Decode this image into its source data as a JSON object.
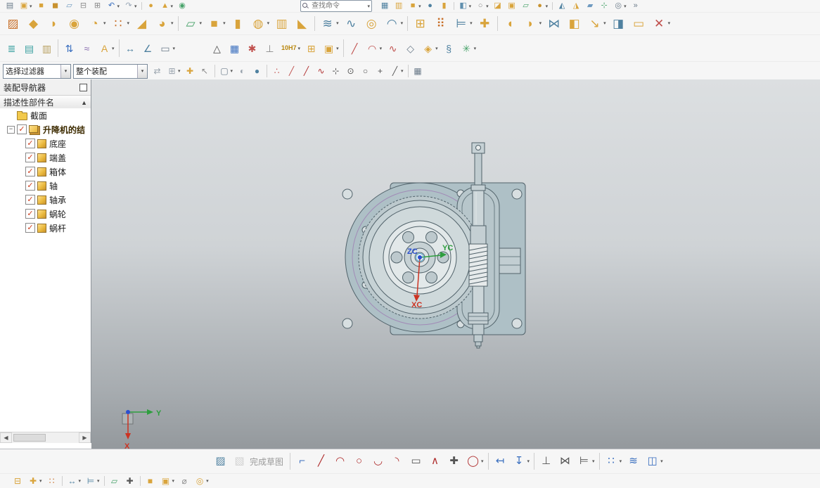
{
  "search": {
    "placeholder": "查找命令"
  },
  "filter_bar": {
    "filter": "选择过滤器",
    "scope": "整个装配"
  },
  "toolbars": {
    "row1a": [
      {
        "n": "window-split",
        "g": "▤",
        "c": "#6b7b8a"
      },
      {
        "n": "part-cube",
        "g": "▣",
        "c": "#d9a43c",
        "dd": true
      },
      {
        "n": "block",
        "g": "■",
        "c": "#d9a43c"
      },
      {
        "n": "cube-shaded",
        "g": "◼",
        "c": "#c8922f"
      },
      {
        "n": "sheet-body",
        "g": "▱",
        "c": "#6f9ac0"
      },
      {
        "n": "copy",
        "g": "⊟",
        "c": "#8a8a8a"
      },
      {
        "n": "paste",
        "g": "⊞",
        "c": "#8a8a8a"
      },
      {
        "n": "undo",
        "g": "↶",
        "c": "#3a6fbf",
        "dd": true
      },
      {
        "n": "redo",
        "g": "↷",
        "c": "#9aa8b8",
        "dd": true
      },
      {
        "sep": true
      },
      {
        "n": "sphere-tool",
        "g": "●",
        "c": "#d9a43c"
      },
      {
        "n": "cone-tool",
        "g": "▲",
        "c": "#d9a43c",
        "dd": true
      },
      {
        "n": "touch-mode",
        "g": "◉",
        "c": "#49a36b"
      }
    ],
    "row1b": [
      {
        "n": "window-grid",
        "g": "▦",
        "c": "#4f81a0"
      },
      {
        "n": "cascade-windows",
        "g": "▥",
        "c": "#d9a43c"
      },
      {
        "n": "cube-small",
        "g": "■",
        "c": "#d9a43c",
        "dd": true
      },
      {
        "n": "sphere-small",
        "g": "●",
        "c": "#4f81a0"
      },
      {
        "n": "cylinder-small",
        "g": "▮",
        "c": "#d9a43c"
      },
      {
        "sep": true
      },
      {
        "n": "shaded-view",
        "g": "◧",
        "c": "#5f8fae",
        "dd": true
      },
      {
        "n": "wireframe-view",
        "g": "○",
        "c": "#8a8a8a",
        "dd": true
      },
      {
        "n": "half-section-view",
        "g": "◪",
        "c": "#d9a43c"
      },
      {
        "n": "cube-pair",
        "g": "▣",
        "c": "#d9a43c"
      },
      {
        "n": "datum-plane-small",
        "g": "▱",
        "c": "#49a36b"
      },
      {
        "n": "sphere-gold",
        "g": "●",
        "c": "#c8922f",
        "dd": true
      },
      {
        "sep": true
      },
      {
        "n": "trim-view",
        "g": "◭",
        "c": "#4f81a0"
      },
      {
        "n": "extend-view",
        "g": "◮",
        "c": "#d9a43c"
      },
      {
        "n": "face-tool",
        "g": "▰",
        "c": "#6f9ac0"
      },
      {
        "n": "datum-axis",
        "g": "⊹",
        "c": "#49a36b"
      },
      {
        "n": "find-measure",
        "g": "◎",
        "c": "#6b7b8a",
        "dd": true
      },
      {
        "n": "more-tools",
        "g": "»",
        "c": "#6b7b8a"
      }
    ],
    "row2": [
      {
        "n": "direct-sketch",
        "g": "▨",
        "c": "#c8702a"
      },
      {
        "n": "extrude",
        "g": "◆",
        "c": "#d9a43c"
      },
      {
        "n": "revolve",
        "g": "◗",
        "c": "#d9a43c"
      },
      {
        "n": "hole",
        "g": "◉",
        "c": "#d9a43c"
      },
      {
        "n": "unite-boolean",
        "g": "◔",
        "c": "#d9a43c",
        "dd": true
      },
      {
        "n": "pattern-feature",
        "g": "∷",
        "c": "#c8702a",
        "dd": true
      },
      {
        "n": "chamfer",
        "g": "◢",
        "c": "#d9a43c"
      },
      {
        "n": "edge-blend",
        "g": "◕",
        "c": "#d9a43c",
        "dd": true
      },
      {
        "sep": true
      },
      {
        "n": "datum-plane",
        "g": "▱",
        "c": "#49a36b",
        "dd": true
      },
      {
        "n": "block-primitive",
        "g": "■",
        "c": "#d9a43c",
        "dd": true
      },
      {
        "n": "cylinder-primitive",
        "g": "▮",
        "c": "#d9a43c"
      },
      {
        "n": "boolean-ops",
        "g": "◍",
        "c": "#d9a43c",
        "dd": true
      },
      {
        "n": "shell",
        "g": "▥",
        "c": "#d9a43c"
      },
      {
        "n": "draft",
        "g": "◣",
        "c": "#d9a43c"
      },
      {
        "sep": true
      },
      {
        "n": "through-curves",
        "g": "≋",
        "c": "#4f81a0",
        "dd": true
      },
      {
        "n": "sweep-along-guide",
        "g": "∿",
        "c": "#4f81a0"
      },
      {
        "n": "tube",
        "g": "◎",
        "c": "#d9a43c"
      },
      {
        "n": "surface",
        "g": "◠",
        "c": "#4f81a0",
        "dd": true
      },
      {
        "sep": true
      },
      {
        "n": "add-component",
        "g": "⊞",
        "c": "#d9a43c"
      },
      {
        "n": "pattern-component",
        "g": "⠿",
        "c": "#c8702a"
      },
      {
        "n": "assembly-constraint",
        "g": "⊨",
        "c": "#4f81a0",
        "dd": true
      },
      {
        "n": "move-component",
        "g": "✚",
        "c": "#d9a43c"
      },
      {
        "sep": true
      },
      {
        "n": "face-blend",
        "g": "◖",
        "c": "#d9a43c"
      },
      {
        "n": "styled-blend",
        "g": "◗",
        "c": "#d9a43c",
        "dd": true
      },
      {
        "n": "sew",
        "g": "⋈",
        "c": "#4f81a0"
      },
      {
        "n": "thicken",
        "g": "◧",
        "c": "#d9a43c"
      },
      {
        "n": "scale-body",
        "g": "↘",
        "c": "#d9a43c",
        "dd": true
      },
      {
        "n": "offset-surface",
        "g": "◨",
        "c": "#4f81a0"
      },
      {
        "n": "replace-face",
        "g": "▭",
        "c": "#d9a43c"
      },
      {
        "n": "delete-face",
        "g": "✕",
        "c": "#c0504d",
        "dd": true
      }
    ],
    "row3": [
      {
        "n": "layer-stack",
        "g": "≣",
        "c": "#3aa0a0"
      },
      {
        "n": "sheet-stack",
        "g": "▤",
        "c": "#3aa0a0"
      },
      {
        "n": "pages",
        "g": "▥",
        "c": "#b8a060"
      },
      {
        "sep": true
      },
      {
        "n": "interpart-link",
        "g": "⇅",
        "c": "#3a6fbf"
      },
      {
        "n": "wave-geometry",
        "g": "≈",
        "c": "#8a6fb0"
      },
      {
        "n": "text-feature",
        "g": "A",
        "c": "#d9a43c",
        "dd": true
      },
      {
        "sep": true
      },
      {
        "n": "dimension-linear",
        "g": "↔",
        "c": "#4f81a0"
      },
      {
        "n": "dimension-angular",
        "g": "∠",
        "c": "#4f81a0"
      },
      {
        "n": "note-annotation",
        "g": "▭",
        "c": "#6b7b8a",
        "dd": true
      },
      {
        "gap": true
      },
      {
        "n": "datum-triangle",
        "g": "△",
        "c": "#4a4a4a"
      },
      {
        "n": "grid-table",
        "g": "▦",
        "c": "#3a6fbf"
      },
      {
        "n": "feature-star",
        "g": "✱",
        "c": "#c0504d"
      },
      {
        "n": "weld-assistant",
        "g": "⊥",
        "c": "#8a8a8a"
      },
      {
        "n": "tolerance-10h7",
        "text": "10H7",
        "c": "#b8860b",
        "dd": true
      },
      {
        "n": "cube-pair-gold",
        "g": "⊞",
        "c": "#d9a43c"
      },
      {
        "n": "cube-group",
        "g": "▣",
        "c": "#d9a43c",
        "dd": true
      },
      {
        "sep": true
      },
      {
        "n": "sketch-line",
        "g": "╱",
        "c": "#c0504d"
      },
      {
        "n": "sketch-arc",
        "g": "◠",
        "c": "#c0504d",
        "dd": true
      },
      {
        "n": "studio-spline",
        "g": "∿",
        "c": "#c0504d"
      },
      {
        "n": "lasso",
        "g": "◇",
        "c": "#6b7b8a"
      },
      {
        "n": "surface-pair",
        "g": "◈",
        "c": "#d9a43c",
        "dd": true
      },
      {
        "n": "section-curve",
        "g": "§",
        "c": "#4f81a0"
      },
      {
        "n": "swirl-surface",
        "g": "✳",
        "c": "#49a36b",
        "dd": true
      }
    ],
    "row4": [
      {
        "n": "interpart-copy",
        "g": "⇄",
        "c": "#9aa4ae"
      },
      {
        "n": "paste-component",
        "g": "⊞",
        "c": "#9aa4ae",
        "dd": true
      },
      {
        "n": "plus-gold",
        "g": "✚",
        "c": "#d9a43c"
      },
      {
        "n": "pointer-select",
        "g": "↖",
        "c": "#8a8a8a"
      },
      {
        "sep": true
      },
      {
        "n": "selection-rectangle",
        "g": "▢",
        "c": "#6b7b8a",
        "dd": true
      },
      {
        "n": "sphere-gray",
        "g": "◐",
        "c": "#9aa4ae"
      },
      {
        "n": "sphere-blue",
        "g": "●",
        "c": "#4f81a0"
      },
      {
        "sep": true
      },
      {
        "n": "snap-point-enable",
        "g": "∴",
        "c": "#c0504d"
      },
      {
        "n": "snap-endpoint",
        "g": "╱",
        "c": "#c0504d"
      },
      {
        "n": "snap-midpoint",
        "g": "╱",
        "c": "#b03030"
      },
      {
        "n": "snap-on-curve",
        "g": "∿",
        "c": "#b03030"
      },
      {
        "n": "snap-intersection",
        "g": "⊹",
        "c": "#555555"
      },
      {
        "n": "snap-arc-center",
        "g": "⊙",
        "c": "#555555"
      },
      {
        "n": "snap-circle",
        "g": "○",
        "c": "#555555"
      },
      {
        "n": "snap-point",
        "g": "+",
        "c": "#555555"
      },
      {
        "n": "snap-angle",
        "g": "╱",
        "c": "#555555",
        "dd": true
      },
      {
        "sep": true
      },
      {
        "n": "grid-snap",
        "g": "▦",
        "c": "#6b7b8a"
      }
    ]
  },
  "navigator": {
    "title": "装配导航器",
    "column": "描述性部件名",
    "sort_glyph": "▲",
    "items": [
      {
        "label": "截面",
        "type": "folder",
        "level": 1
      },
      {
        "label": "升降机的结",
        "type": "assembly",
        "level": 0,
        "checked": true,
        "expander": "−",
        "bold": true
      },
      {
        "label": "底座",
        "type": "part",
        "level": 2,
        "checked": true
      },
      {
        "label": "端盖",
        "type": "part",
        "level": 2,
        "checked": true
      },
      {
        "label": "箱体",
        "type": "part",
        "level": 2,
        "checked": true
      },
      {
        "label": "轴",
        "type": "part",
        "level": 2,
        "checked": true
      },
      {
        "label": "轴承",
        "type": "part",
        "level": 2,
        "checked": true
      },
      {
        "label": "蜗轮",
        "type": "part",
        "level": 2,
        "checked": true
      },
      {
        "label": "蜗杆",
        "type": "part",
        "level": 2,
        "checked": true
      }
    ]
  },
  "viewport": {
    "wcs": {
      "zc": "ZC",
      "yc": "YC",
      "xc": "XC"
    },
    "triad": {
      "x": "X",
      "y": "Y"
    },
    "colors": {
      "axis_x": "#cc3322",
      "axis_y": "#2e9e3e",
      "axis_z": "#2b4fd0"
    }
  },
  "bottom": {
    "finish_label": "完成草图",
    "icons1": [
      {
        "n": "sketch-task",
        "g": "▨",
        "c": "#4f81a0"
      },
      {
        "n": "finish-sketch",
        "g": "▧",
        "c": "#999999",
        "disabled": true
      },
      {
        "labelBind": "bottom.finish_label"
      },
      {
        "sep": true
      },
      {
        "n": "profile",
        "g": "⌐",
        "c": "#3a6fbf"
      },
      {
        "n": "line",
        "g": "╱",
        "c": "#b03030"
      },
      {
        "n": "arc",
        "g": "◠",
        "c": "#b03030"
      },
      {
        "n": "circle",
        "g": "○",
        "c": "#b03030"
      },
      {
        "n": "arc-3point",
        "g": "◡",
        "c": "#b03030"
      },
      {
        "n": "fillet-corner",
        "g": "◝",
        "c": "#b03030"
      },
      {
        "n": "rectangle",
        "g": "▭",
        "c": "#555555"
      },
      {
        "n": "polyline",
        "g": "∧",
        "c": "#b03030"
      },
      {
        "n": "point",
        "g": "✚",
        "c": "#555555"
      },
      {
        "n": "ellipse",
        "g": "◯",
        "c": "#b03030",
        "dd": true
      },
      {
        "sep": true
      },
      {
        "n": "rapid-dimension",
        "g": "↤",
        "c": "#3a6fbf"
      },
      {
        "n": "dimension",
        "g": "↧",
        "c": "#3a6fbf",
        "dd": true
      },
      {
        "sep": true
      },
      {
        "n": "geometric-constraint",
        "g": "⊥",
        "c": "#555555"
      },
      {
        "n": "make-symmetric",
        "g": "⋈",
        "c": "#555555"
      },
      {
        "n": "auto-constrain",
        "g": "⊨",
        "c": "#555555",
        "dd": true
      },
      {
        "sep": true
      },
      {
        "n": "pattern-curve",
        "g": "∷",
        "c": "#3a6fbf",
        "dd": true
      },
      {
        "n": "offset-curve",
        "g": "≋",
        "c": "#3a6fbf"
      },
      {
        "n": "mirror-curve",
        "g": "◫",
        "c": "#3a6fbf",
        "dd": true
      }
    ],
    "icons2": [
      {
        "n": "assembly-navigator-toggle",
        "g": "⊟",
        "c": "#d9a43c"
      },
      {
        "n": "add-component-2",
        "g": "✚",
        "c": "#d9a43c",
        "dd": true
      },
      {
        "n": "component-array",
        "g": "∷",
        "c": "#c8702a"
      },
      {
        "sep": true
      },
      {
        "n": "move-component-2",
        "g": "↔",
        "c": "#4f81a0",
        "dd": true
      },
      {
        "n": "assembly-constraints-2",
        "g": "⊨",
        "c": "#4f81a0",
        "dd": true
      },
      {
        "sep": true
      },
      {
        "n": "datum-plane-3",
        "g": "▱",
        "c": "#49a36b"
      },
      {
        "n": "point-tool",
        "g": "✚",
        "c": "#555555"
      },
      {
        "sep": true
      },
      {
        "n": "cube-a",
        "g": "■",
        "c": "#d9a43c"
      },
      {
        "n": "cube-b",
        "g": "▣",
        "c": "#d9a43c",
        "dd": true
      },
      {
        "n": "bolt-tool",
        "g": "⌀",
        "c": "#8a8a8a"
      },
      {
        "n": "washer-tool",
        "g": "◎",
        "c": "#d9a43c",
        "dd": true
      }
    ]
  }
}
